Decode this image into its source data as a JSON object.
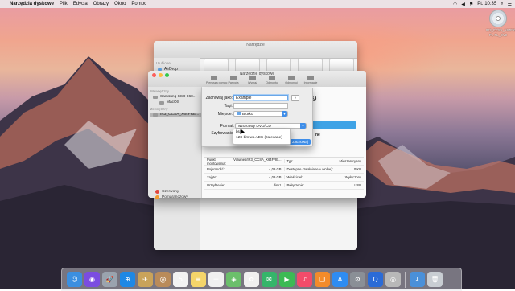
{
  "menubar": {
    "apple_glyph": "",
    "items": [
      "Narzędzia dyskowe",
      "Plik",
      "Edycja",
      "Obrazy",
      "Okno",
      "Pomoc"
    ],
    "clock": "Pt. 10:35",
    "status_icons": [
      "wifi-icon",
      "volume-icon",
      "flag-icon",
      "search-icon",
      "list-icon"
    ]
  },
  "desktop_disk": {
    "label1": "IR3_CCSA_X64FRE",
    "label2": "PL-PL_DV9"
  },
  "finder": {
    "title": "Narzędzie",
    "sidebar_heading": "Ulubione",
    "sidebar_items": [
      "AirDrop"
    ],
    "tags": [
      {
        "label": "Czerwony",
        "color": "#e0463d"
      },
      {
        "label": "Pomarańczowy",
        "color": "#f39a2d"
      }
    ]
  },
  "disk_utility": {
    "title": "Narzędzie dyskowe",
    "toolbar": [
      "Pierwsza pomoc",
      "Partycja",
      "Wymaż",
      "Odmontuj",
      "Odmontuj",
      "Informacje"
    ],
    "sidebar": {
      "heading_internal": "Wewnętrzny",
      "internal_disk": "Samsung SSD 860...",
      "internal_volume": "MacOS",
      "heading_external": "Zewnętrzny",
      "external_disk": "IR3_CCSA_X64FRE..."
    },
    "big_name": "9",
    "free_label": "ne",
    "info": [
      [
        "Punkt montowania:",
        "/Volumes/IR3_CCSA_X64FRE...",
        "Typ:",
        "Mieszanicyany"
      ],
      [
        "Pojemność:",
        "4,09 GB",
        "Dostępne (zwalniane + wolne):",
        "0 KB"
      ],
      [
        "Zajęte:",
        "4,09 GB",
        "Właściciel:",
        "Wyłączony"
      ],
      [
        "Urządzenie:",
        "disk1",
        "Połączenie:",
        "USB"
      ]
    ]
  },
  "save_sheet": {
    "save_as_label": "Zachowaj jako:",
    "save_as_value": "Example",
    "tags_label": "Tagi:",
    "where_label": "Miejsce:",
    "where_value": "Biurko",
    "format_label": "Format:",
    "format_value": "wzorcowy DVD/CD",
    "encryption_label": "Szyfrowanie:",
    "encryption_options": [
      "brak",
      "128-bitowa AES (zalecane)"
    ],
    "cancel_label": "Anuluj",
    "save_label": "Zachowaj"
  },
  "dock": [
    {
      "name": "finder-icon",
      "glyph": "☺",
      "color": "#3b8fe0"
    },
    {
      "name": "siri-icon",
      "glyph": "◉",
      "color": "#7b4ce0"
    },
    {
      "name": "launchpad-icon",
      "glyph": "🚀",
      "color": "#9aa3ae"
    },
    {
      "name": "safari-icon",
      "glyph": "⊕",
      "color": "#1e88e5"
    },
    {
      "name": "mail-icon",
      "glyph": "✈",
      "color": "#c9a35a"
    },
    {
      "name": "contacts-icon",
      "glyph": "@",
      "color": "#b98b5a"
    },
    {
      "name": "calendar-icon",
      "glyph": "5",
      "color": "#f2f2f2"
    },
    {
      "name": "notes-icon",
      "glyph": "≡",
      "color": "#f5d56a"
    },
    {
      "name": "reminders-icon",
      "glyph": "☰",
      "color": "#f0f0f0"
    },
    {
      "name": "maps-icon",
      "glyph": "◈",
      "color": "#6bbf6b"
    },
    {
      "name": "photos-icon",
      "glyph": "✿",
      "color": "#f0f0f0"
    },
    {
      "name": "messages-icon",
      "glyph": "✉",
      "color": "#35b56a"
    },
    {
      "name": "facetime-icon",
      "glyph": "▶",
      "color": "#3cba54"
    },
    {
      "name": "music-icon",
      "glyph": "♪",
      "color": "#f24b6a"
    },
    {
      "name": "books-icon",
      "glyph": "❑",
      "color": "#f38b2a"
    },
    {
      "name": "appstore-icon",
      "glyph": "A",
      "color": "#2f8cf2"
    },
    {
      "name": "preferences-icon",
      "glyph": "⚙",
      "color": "#8a8f96"
    },
    {
      "name": "quicktime-icon",
      "glyph": "Q",
      "color": "#2b6bd6"
    },
    {
      "name": "diskutility-icon",
      "glyph": "◎",
      "color": "#b8b8b8"
    },
    {
      "name": "downloads-icon",
      "glyph": "↓",
      "color": "#4a90d9"
    },
    {
      "name": "trash-icon",
      "glyph": "🗑",
      "color": "#c8cdd2"
    }
  ]
}
